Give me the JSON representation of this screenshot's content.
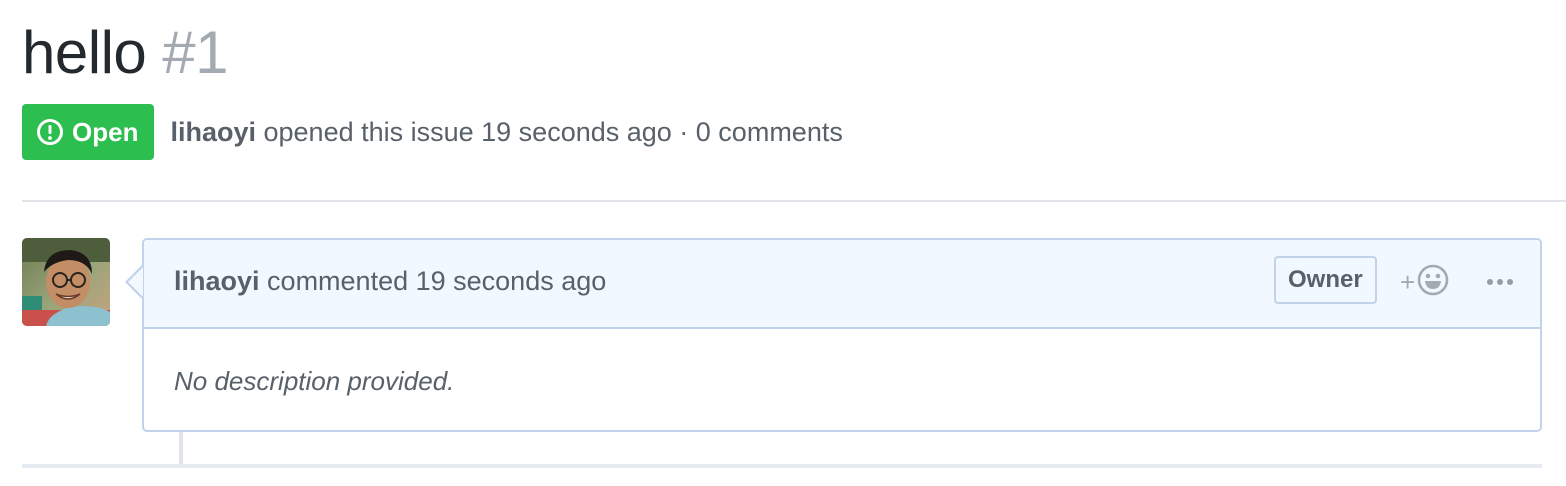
{
  "issue": {
    "title": "hello",
    "number": "#1"
  },
  "state": {
    "label": "Open",
    "icon": "issue-opened-icon",
    "color": "#2cbe4e"
  },
  "meta": {
    "author": "lihaoyi",
    "summary": "opened this issue 19 seconds ago · 0 comments"
  },
  "comment": {
    "author": "lihaoyi",
    "action_time": "commented 19 seconds ago",
    "role_badge": "Owner",
    "body": "No description provided.",
    "reaction_icon": "add-reaction-smiley-icon",
    "reaction_plus": "+",
    "more_icon": "kebab-horizontal-icon"
  },
  "colors": {
    "header_bg": "#f1f8ff",
    "border": "#c0d3eb",
    "muted_text": "#586069",
    "title_text": "#24292e",
    "number_text": "#a3aab1"
  }
}
